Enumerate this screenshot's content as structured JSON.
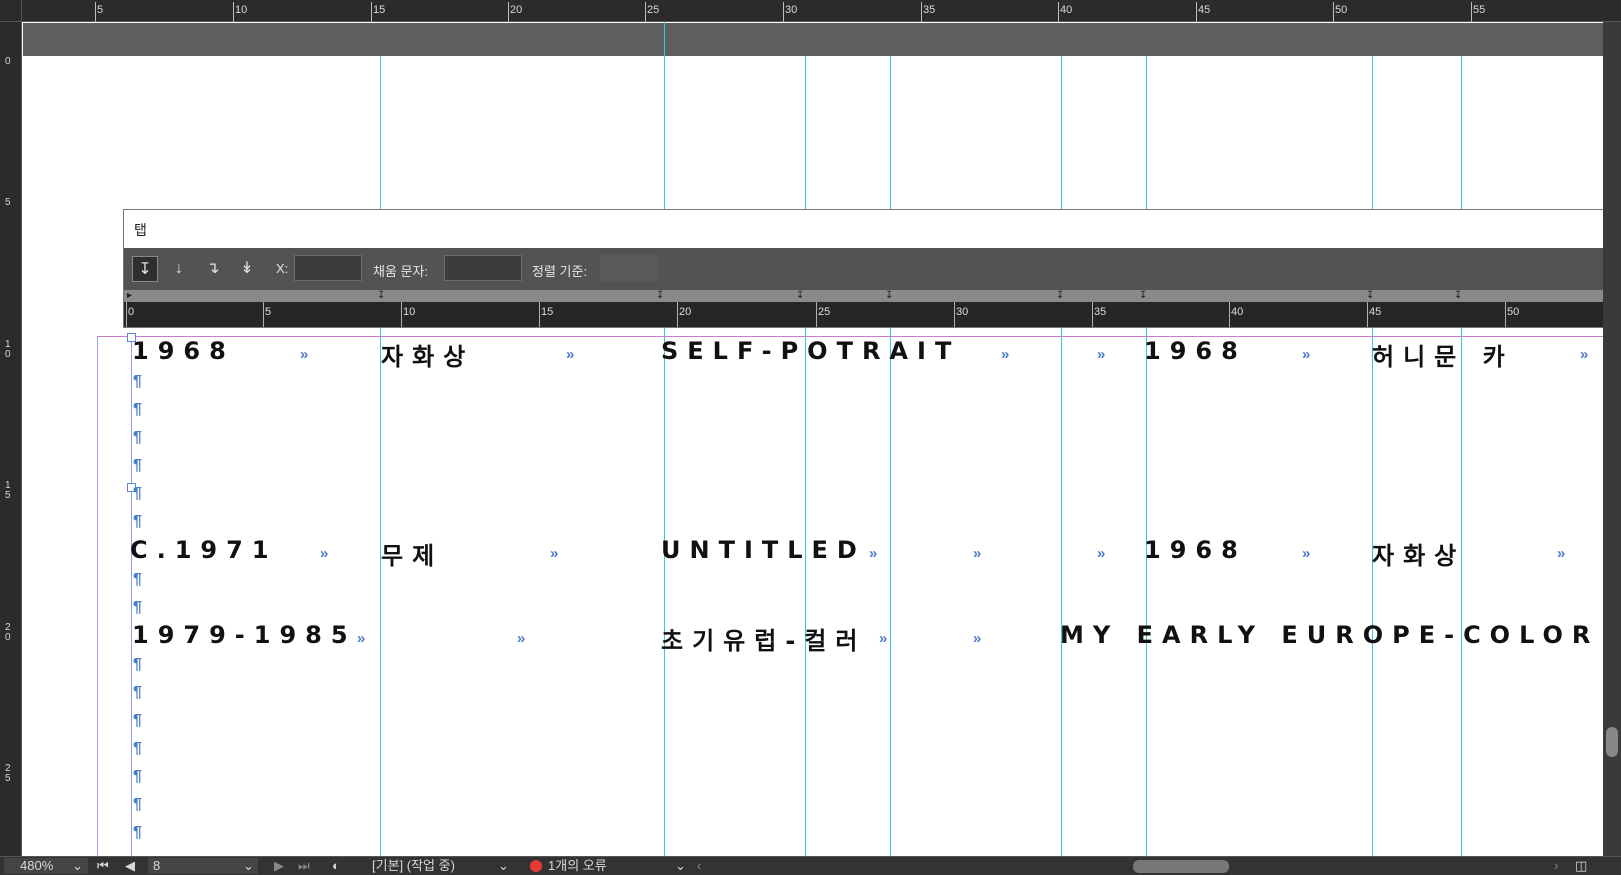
{
  "ruler": {
    "top_labels": [
      "5",
      "10",
      "15",
      "20",
      "25",
      "30",
      "35",
      "40",
      "45",
      "50",
      "55"
    ],
    "left_labels": [
      "0",
      "5",
      "10",
      "15",
      "20",
      "25"
    ]
  },
  "tabs_panel": {
    "title": "탭",
    "x_label": "X:",
    "x_value": "",
    "leader_label": "채움 문자:",
    "leader_value": "",
    "align_label": "정렬 기준:",
    "align_value": "",
    "buttons": [
      {
        "name": "left-justified-tab-button",
        "icon": "↧",
        "active": true
      },
      {
        "name": "center-justified-tab-button",
        "icon": "↓",
        "active": false
      },
      {
        "name": "right-justified-tab-button",
        "icon": "↴",
        "active": false
      },
      {
        "name": "align-on-decimal-tab-button",
        "icon": "↡",
        "active": false
      }
    ],
    "ruler_labels": [
      "0",
      "5",
      "10",
      "15",
      "20",
      "25",
      "30",
      "35",
      "40",
      "45",
      "50"
    ]
  },
  "document": {
    "rows": [
      {
        "cells": [
          "1968",
          "자화상",
          "SELF-POTRAIT",
          "1968",
          "허니문 카"
        ]
      },
      {
        "cells": [
          "C.1971",
          "무제",
          "UNTITLED",
          "1968",
          "자화상"
        ]
      },
      {
        "cells": [
          "1979-1985",
          "초기유럽-컬러",
          "MY EARLY EUROPE-COLOR"
        ]
      }
    ],
    "tab_glyph": "»",
    "pilcrow_glyph": "¶"
  },
  "statusbar": {
    "zoom": "480%",
    "page": "8",
    "style": "[기본] (작업 중)",
    "errors": "1개의 오류"
  },
  "colors": {
    "guide": "#38c9d6",
    "error": "#e53935",
    "hidden_chars": "#4a7cc9"
  }
}
